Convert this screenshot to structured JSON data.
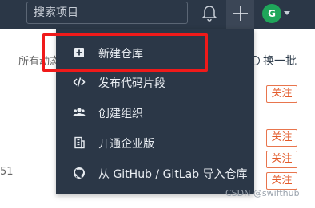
{
  "header": {
    "search_placeholder": "搜索项目",
    "avatar_letter": "G"
  },
  "background": {
    "feed_label": "所有动态",
    "swap_label": "换一批",
    "follow_label": "关注",
    "follow_count": 4,
    "stray_number": "51"
  },
  "menu": {
    "items": [
      {
        "label": "新建仓库",
        "icon": "plus-square-icon"
      },
      {
        "label": "发布代码片段",
        "icon": "code-icon"
      },
      {
        "label": "创建组织",
        "icon": "users-icon"
      },
      {
        "label": "开通企业版",
        "icon": "building-icon"
      },
      {
        "label": "从 GitHub / GitLab 导入仓库",
        "icon": "github-icon"
      }
    ]
  },
  "watermark": "CSDN @swifthub",
  "colors": {
    "topbar": "#2b3747",
    "menu": "#2b3747",
    "avatar": "#1fa65a",
    "follow_border": "#e8754d",
    "highlight": "#f01a1a"
  }
}
